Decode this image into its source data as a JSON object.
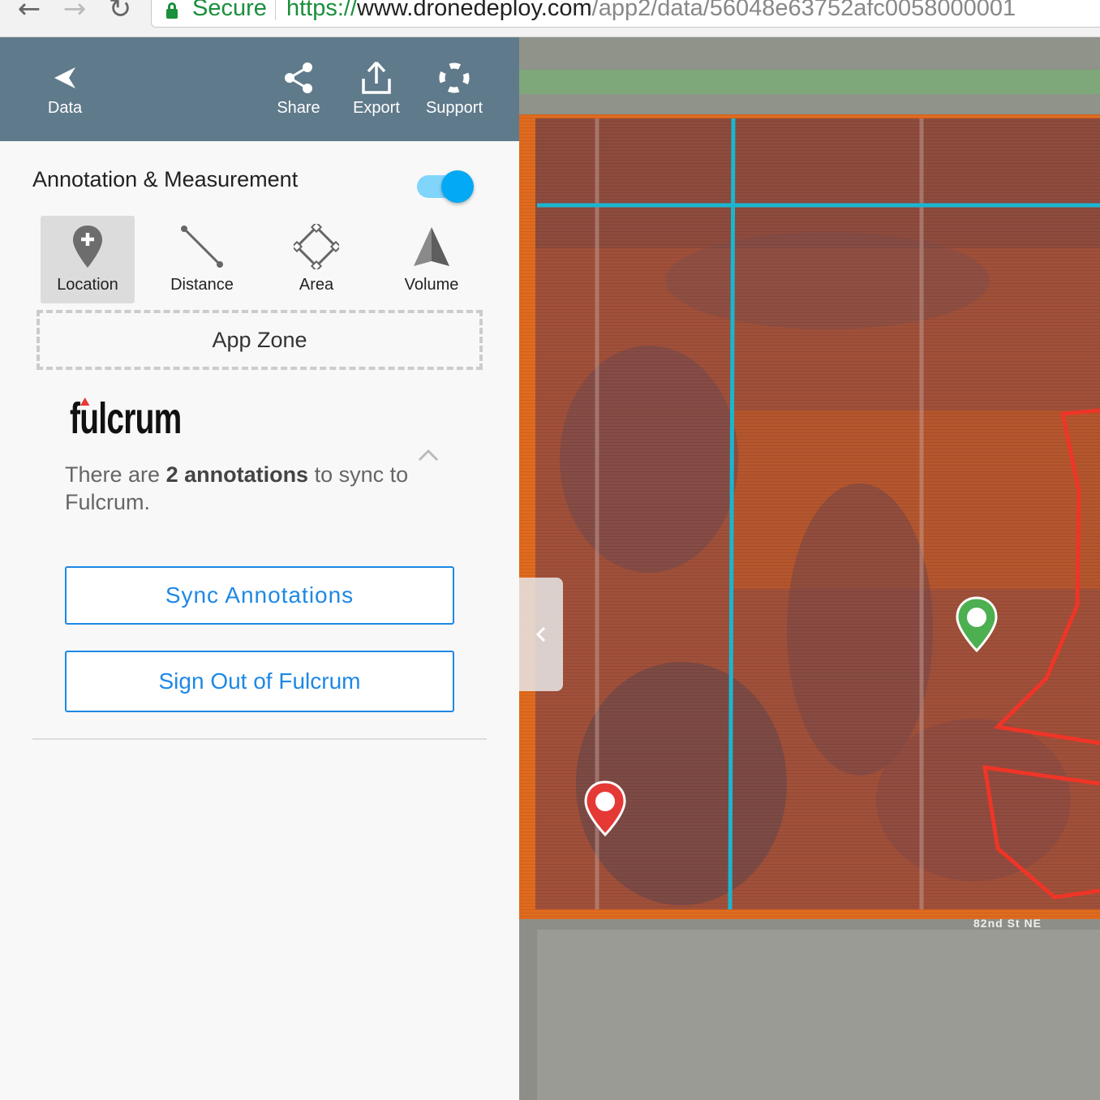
{
  "browser": {
    "secure_label": "Secure",
    "url_protocol": "https://",
    "url_host": "www.dronedeploy.com",
    "url_path": "/app2/data/56048e63752afc0058000001"
  },
  "topbar": {
    "back_label": "Data",
    "share_label": "Share",
    "export_label": "Export",
    "support_label": "Support",
    "bg_color": "#5f7a8b"
  },
  "annotation": {
    "title": "Annotation & Measurement",
    "toggle_on": true,
    "tools": [
      {
        "label": "Location",
        "icon": "location-plus-icon",
        "active": true
      },
      {
        "label": "Distance",
        "icon": "distance-icon",
        "active": false
      },
      {
        "label": "Area",
        "icon": "area-icon",
        "active": false
      },
      {
        "label": "Volume",
        "icon": "volume-icon",
        "active": false
      }
    ]
  },
  "app_zone": {
    "label": "App Zone"
  },
  "fulcrum": {
    "logo_text": "fulcrum",
    "sync_prefix": "There are ",
    "sync_count": "2 annotations",
    "sync_suffix": " to sync to Fulcrum.",
    "sync_button": "Sync Annotations",
    "signout_button": "Sign Out of Fulcrum",
    "accent_color": "#1e88e5"
  },
  "map": {
    "road_label": "82nd St NE",
    "markers": [
      {
        "color": "#4caf50",
        "icon": "map-pin-icon"
      },
      {
        "color": "#e53935",
        "icon": "map-pin-icon"
      }
    ]
  }
}
